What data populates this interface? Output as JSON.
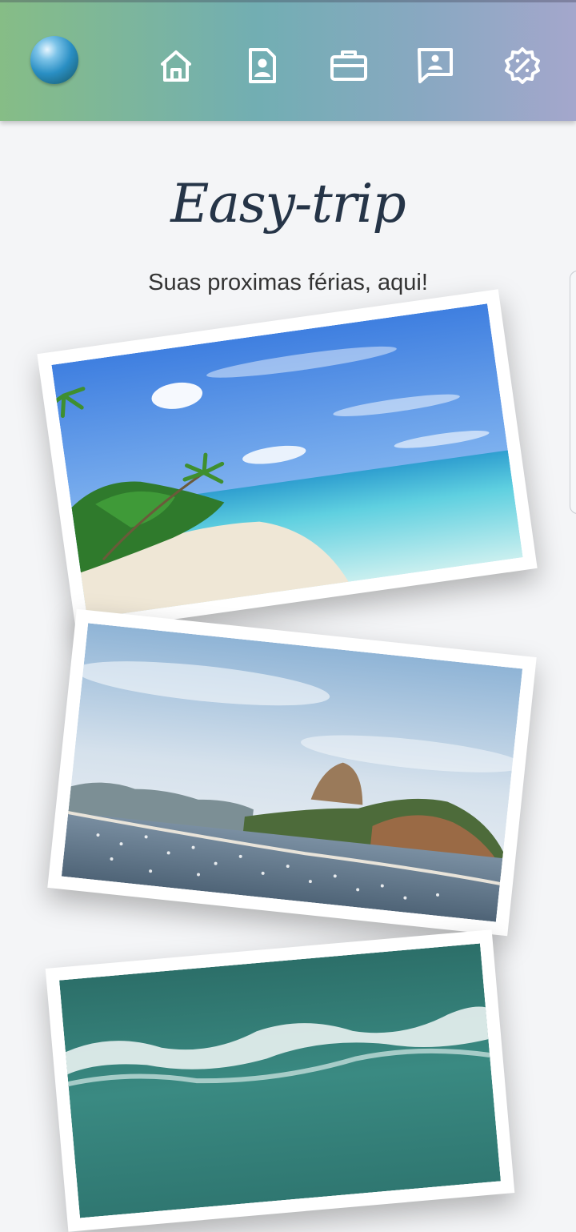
{
  "app": {
    "title": "Easy-trip",
    "subtitle": "Suas proximas férias, aqui!"
  },
  "nav": {
    "items": [
      {
        "icon": "home-icon"
      },
      {
        "icon": "profile-document-icon"
      },
      {
        "icon": "briefcase-icon"
      },
      {
        "icon": "contact-message-icon"
      },
      {
        "icon": "discount-badge-icon"
      }
    ]
  },
  "photos": [
    {
      "subject": "tropical-beach"
    },
    {
      "subject": "sugarloaf-bay"
    },
    {
      "subject": "ocean-waves-aerial"
    }
  ],
  "colors": {
    "header_start": "#86bd86",
    "header_end": "#a4a7cc",
    "title": "#253447",
    "background": "#f4f5f7"
  }
}
